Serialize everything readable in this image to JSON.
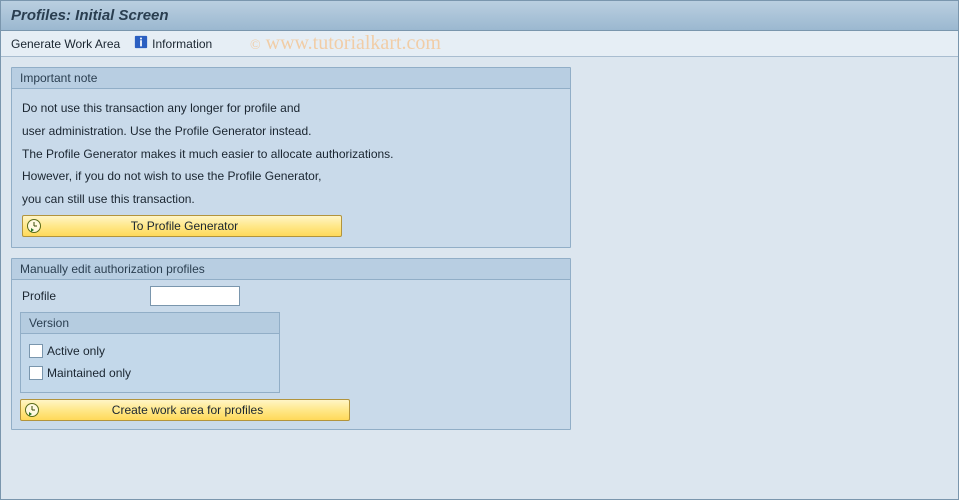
{
  "header": {
    "title": "Profiles: Initial Screen"
  },
  "toolbar": {
    "generate_work_area": "Generate Work Area",
    "information": "Information"
  },
  "watermark": {
    "text": "www.tutorialkart.com",
    "copy": "©"
  },
  "panel_note": {
    "title": "Important note",
    "lines": {
      "l1": "Do not use this transaction any longer for profile and",
      "l2": "user administration. Use the Profile Generator instead.",
      "l3": "The Profile Generator makes it much easier to allocate authorizations.",
      "l4": "However, if you do not wish to use the Profile Generator,",
      "l5": "you can still use this transaction."
    },
    "button_label": "To Profile Generator"
  },
  "panel_edit": {
    "title": "Manually edit authorization profiles",
    "profile_label": "Profile",
    "profile_value": "",
    "version_group": {
      "title": "Version",
      "active_only": "Active only",
      "maintained_only": "Maintained only"
    },
    "button_label": "Create work area for profiles"
  }
}
